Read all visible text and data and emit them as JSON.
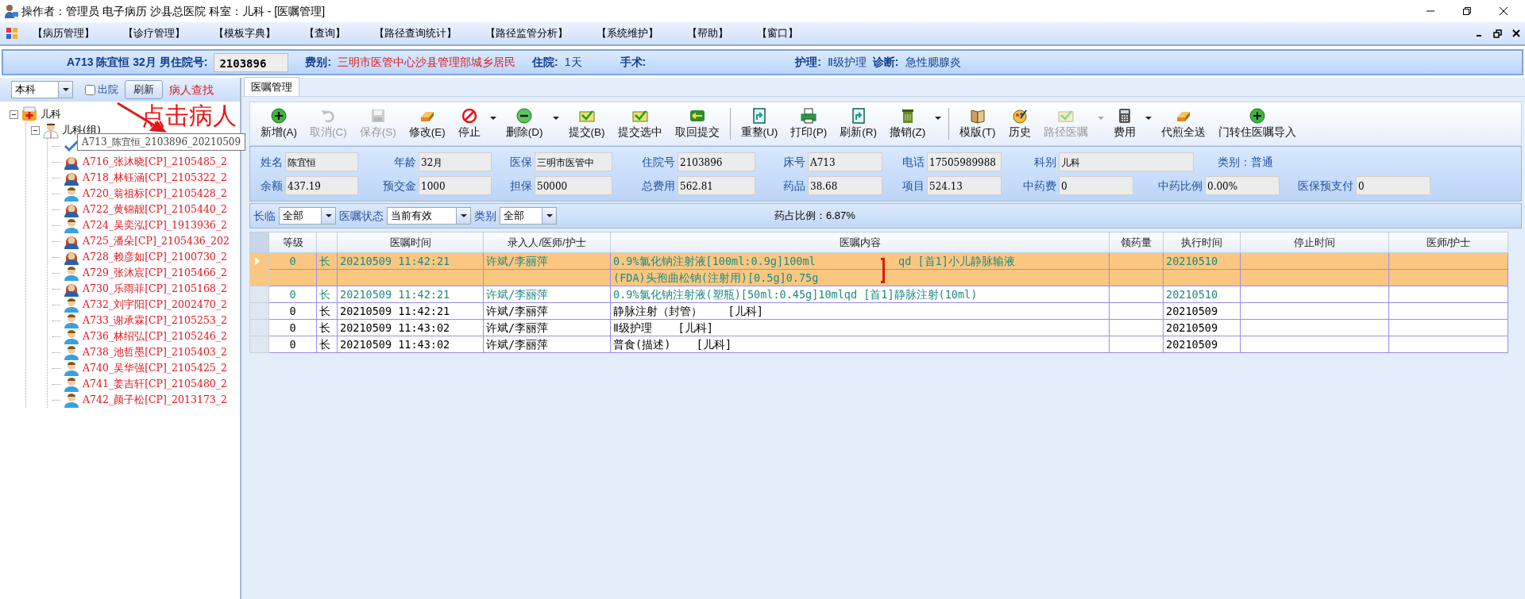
{
  "window": {
    "title": "操作者：管理员 电子病历 沙县总医院 科室：儿科 - [医嘱管理]"
  },
  "menu": [
    "【病历管理】",
    "【诊疗管理】",
    "【模板字典】",
    "【查询】",
    "【路径查询统计】",
    "【路径监管分析】",
    "【系统维护】",
    "【帮助】",
    "【窗口】"
  ],
  "patient_bar": {
    "summary": "A713  陈宜恒 32月 男住院号:",
    "admission_no": "2103896",
    "fee_type_label": "费别:",
    "fee_type": "三明市医管中心沙县管理部城乡居民",
    "stay_label": "住院:",
    "stay": "1天",
    "surgery_label": "手术:",
    "nursing_label": "护理:",
    "nursing": "Ⅱ级护理",
    "diagnosis_label": "诊断:",
    "diagnosis": "急性腮腺炎"
  },
  "left_panel": {
    "scope": "本科",
    "discharged": {
      "label": "出院",
      "checked": false
    },
    "refresh": "刷新",
    "find": "病人查找",
    "tree": [
      {
        "label": "儿科",
        "kind": "department",
        "expanded": true,
        "children": [
          {
            "label": "儿科(组)",
            "kind": "group",
            "expanded": true,
            "children": [
              {
                "kind": "check"
              },
              {
                "label": "A716_张沐晓[CP]_2105485_2",
                "kind": "female"
              },
              {
                "label": "A718_林钰涵[CP]_2105322_2",
                "kind": "female"
              },
              {
                "label": "A720_翁祖标[CP]_2105428_2",
                "kind": "male"
              },
              {
                "label": "A722_黄锦靓[CP]_2105440_2",
                "kind": "female"
              },
              {
                "label": "A724_吴奕泓[CP]_1913936_2",
                "kind": "male"
              },
              {
                "label": "A725_潘朵[CP]_2105436_202",
                "kind": "female"
              },
              {
                "label": "A728_赖彦如[CP]_2100730_2",
                "kind": "female"
              },
              {
                "label": "A729_张沐宸[CP]_2105466_2",
                "kind": "male"
              },
              {
                "label": "A730_乐雨菲[CP]_2105168_2",
                "kind": "female"
              },
              {
                "label": "A732_刘宇阳[CP]_2002470_2",
                "kind": "male"
              },
              {
                "label": "A733_谢承霖[CP]_2105253_2",
                "kind": "male"
              },
              {
                "label": "A736_林绍弘[CP]_2105246_2",
                "kind": "male"
              },
              {
                "label": "A738_池哲墨[CP]_2105403_2",
                "kind": "male"
              },
              {
                "label": "A740_吴华强[CP]_2105425_2",
                "kind": "male"
              },
              {
                "label": "A741_姜吉轩[CP]_2105480_2",
                "kind": "male"
              },
              {
                "label": "A742_颜子松[CP]_2013173_2",
                "kind": "male"
              }
            ]
          }
        ]
      }
    ],
    "tooltip": "A713_陈宜恒_2103896_20210509"
  },
  "annotation": {
    "text": "点击病人"
  },
  "tabs": [
    {
      "label": "医嘱管理",
      "selected": true
    }
  ],
  "toolbar": [
    {
      "label": "新增(A)",
      "kind": "add",
      "disabled": false
    },
    {
      "label": "取消(C)",
      "kind": "undo",
      "disabled": true
    },
    {
      "label": "保存(S)",
      "kind": "save",
      "disabled": true
    },
    {
      "label": "修改(E)",
      "kind": "edit",
      "disabled": false
    },
    {
      "label": "停止",
      "kind": "stop",
      "disabled": false,
      "dropdown": true
    },
    {
      "label": "删除(D)",
      "kind": "remove",
      "disabled": false,
      "dropdown": true
    },
    {
      "label": "提交(B)",
      "kind": "submit",
      "disabled": false
    },
    {
      "label": "提交选中",
      "kind": "submit",
      "disabled": false
    },
    {
      "label": "取回提交",
      "kind": "retrieve",
      "disabled": false,
      "separator": true
    },
    {
      "label": "重整(U)",
      "kind": "document",
      "disabled": false
    },
    {
      "label": "打印(P)",
      "kind": "print",
      "disabled": false
    },
    {
      "label": "刷新(R)",
      "kind": "document",
      "disabled": false
    },
    {
      "label": "撤销(Z)",
      "kind": "trash",
      "disabled": false,
      "dropdown": true,
      "separator": true
    },
    {
      "label": "模版(T)",
      "kind": "book",
      "disabled": false
    },
    {
      "label": "历史",
      "kind": "history",
      "disabled": false
    },
    {
      "label": "路径医嘱",
      "kind": "submit",
      "disabled": true,
      "dropdown": true
    },
    {
      "label": "费用",
      "kind": "calc",
      "disabled": false,
      "dropdown": true
    },
    {
      "label": "代煎全送",
      "kind": "edit",
      "disabled": false
    },
    {
      "label": "门转住医嘱导入",
      "kind": "add",
      "disabled": false
    }
  ],
  "patient_info": [
    [
      {
        "label": "姓名",
        "value": "陈宜恒"
      },
      {
        "label": "年龄",
        "value": "32月"
      },
      {
        "label": "医保",
        "value": "三明市医管中"
      },
      {
        "label": "住院号",
        "value": "2103896"
      },
      {
        "label": "床号",
        "value": "A713"
      },
      {
        "label": "电话",
        "value": "17505989988"
      },
      {
        "label": "科别",
        "value": "儿科",
        "kind": "wide"
      },
      {
        "label": "类别：普通",
        "kind": "text"
      }
    ],
    [
      {
        "label": "余额",
        "value": "437.19"
      },
      {
        "label": "预交金",
        "value": "1000"
      },
      {
        "label": "担保",
        "value": "50000"
      },
      {
        "label": "总费用",
        "value": "562.81"
      },
      {
        "label": "药品",
        "value": "38.68"
      },
      {
        "label": "项目",
        "value": "524.13"
      },
      {
        "label": "中药费",
        "value": "0"
      },
      {
        "label": "中药比例",
        "value": "0.00%"
      },
      {
        "label": "医保预支付",
        "value": "0"
      }
    ]
  ],
  "filters": [
    {
      "label": "长临",
      "value": "全部"
    },
    {
      "label": "医嘱状态",
      "value": "当前有效"
    },
    {
      "label": "类别",
      "value": "全部"
    }
  ],
  "drug_ratio": "药占比例：6.87%",
  "table": {
    "columns": [
      "等级",
      "",
      "医嘱时间",
      "录入人/医师/护士",
      "医嘱内容",
      "领药量",
      "执行时间",
      "停止时间",
      "医师/护士"
    ],
    "rows": [
      {
        "selected": true,
        "color": "#1e8a84",
        "level": "0",
        "type": "长",
        "time": "20210509 11:42:21",
        "staff": "许斌/李丽萍",
        "content": [
          "0.9%氯化钠注射液[100ml:0.9g]100ml",
          "(FDA)头孢曲松钠(注射用)[0.5g]0.75g"
        ],
        "usage": "qd [首1]小儿静脉输液",
        "exec_time": "20210510"
      },
      {
        "selected": false,
        "color": "#1e8a84",
        "level": "0",
        "type": "长",
        "time": "20210509 11:42:21",
        "staff": "许斌/李丽萍",
        "content": [
          "0.9%氯化钠注射液(塑瓶)[50ml:0.45g]10mlqd [首1]静脉注射(10ml)"
        ],
        "exec_time": "20210510"
      },
      {
        "selected": false,
        "color": "#000000",
        "level": "0",
        "type": "长",
        "time": "20210509 11:42:21",
        "staff": "许斌/李丽萍",
        "content": [
          "静脉注射（封管）    [儿科]"
        ],
        "exec_time": "20210509"
      },
      {
        "selected": false,
        "color": "#000000",
        "level": "0",
        "type": "长",
        "time": "20210509 11:43:02",
        "staff": "许斌/李丽萍",
        "content": [
          "Ⅱ级护理    [儿科]"
        ],
        "exec_time": "20210509"
      },
      {
        "selected": false,
        "color": "#000000",
        "level": "0",
        "type": "长",
        "time": "20210509 11:43:02",
        "staff": "许斌/李丽萍",
        "content": [
          "普食(描述)    [儿科]"
        ],
        "exec_time": "20210509"
      }
    ]
  }
}
